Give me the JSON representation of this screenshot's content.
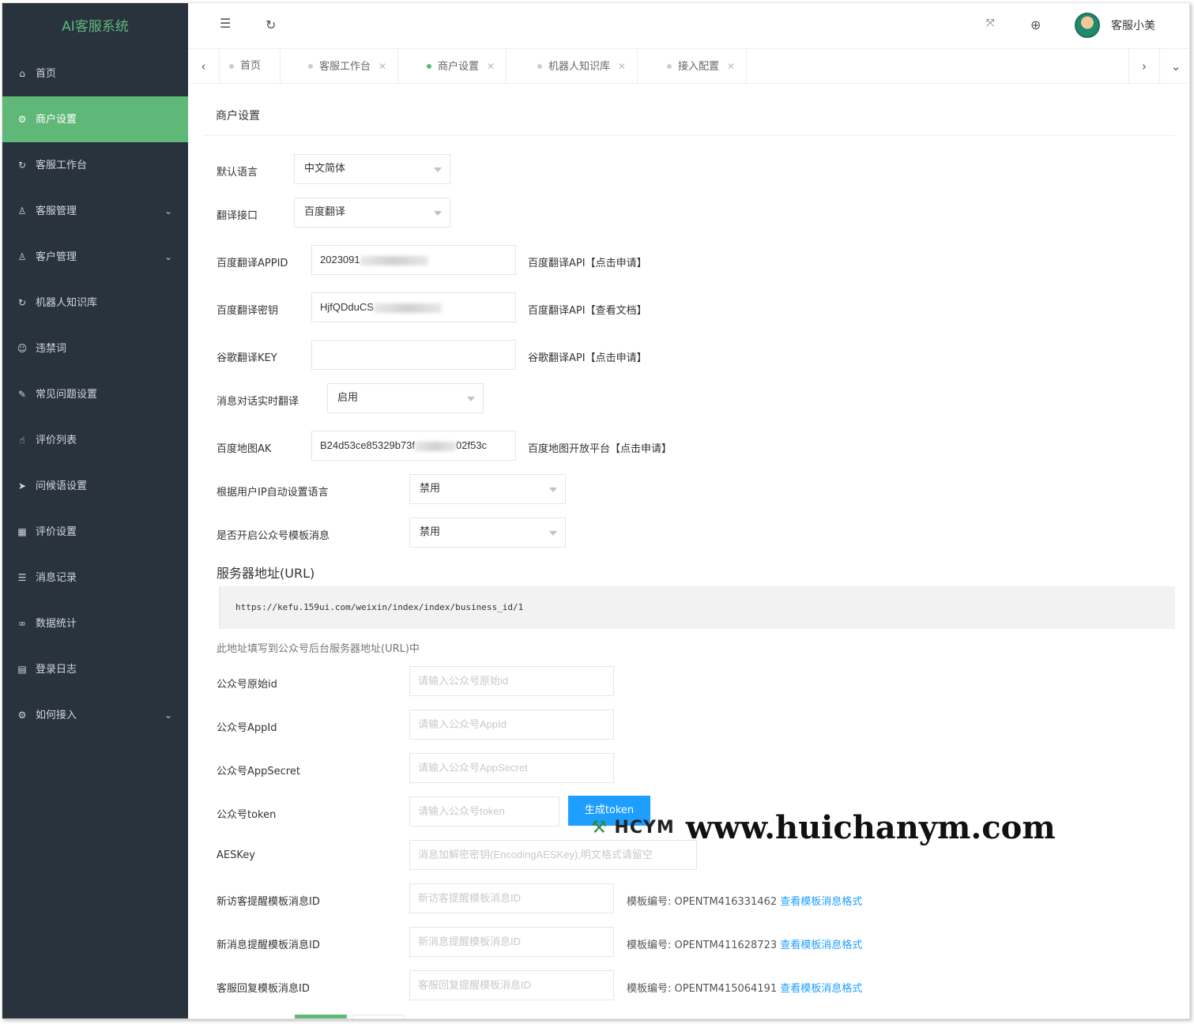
{
  "app": {
    "title": "AI客服系统"
  },
  "sidebar": {
    "items": [
      {
        "label": "首页",
        "icon": "home-icon",
        "glyph": "⌂"
      },
      {
        "label": "商户设置",
        "icon": "gear-icon",
        "glyph": "⚙"
      },
      {
        "label": "客服工作台",
        "icon": "refresh-icon",
        "glyph": "↻"
      },
      {
        "label": "客服管理",
        "icon": "user-icon",
        "glyph": "♙"
      },
      {
        "label": "客户管理",
        "icon": "users-icon",
        "glyph": "♙"
      },
      {
        "label": "机器人知识库",
        "icon": "refresh-icon",
        "glyph": "↻"
      },
      {
        "label": "违禁词",
        "icon": "face-icon",
        "glyph": "☺"
      },
      {
        "label": "常见问题设置",
        "icon": "edit-icon",
        "glyph": "✎"
      },
      {
        "label": "评价列表",
        "icon": "thumb-icon",
        "glyph": "☝"
      },
      {
        "label": "问候语设置",
        "icon": "send-icon",
        "glyph": "➤"
      },
      {
        "label": "评价设置",
        "icon": "calendar-icon",
        "glyph": "▦"
      },
      {
        "label": "消息记录",
        "icon": "list-icon",
        "glyph": "☰"
      },
      {
        "label": "数据统计",
        "icon": "link-icon",
        "glyph": "∞"
      },
      {
        "label": "登录日志",
        "icon": "table-icon",
        "glyph": "▤"
      },
      {
        "label": "如何接入",
        "icon": "gear-icon",
        "glyph": "⚙"
      }
    ],
    "active_index": 1,
    "expandable": [
      3,
      4,
      14
    ]
  },
  "header": {
    "menu_icon": "menu-icon",
    "refresh_icon": "refresh-icon",
    "fullscreen_icon": "fullscreen-icon",
    "globe_icon": "globe-icon",
    "username": "客服小美"
  },
  "tabs": [
    {
      "label": "首页",
      "closable": false
    },
    {
      "label": "客服工作台",
      "closable": true
    },
    {
      "label": "商户设置",
      "closable": true,
      "active": true
    },
    {
      "label": "机器人知识库",
      "closable": true
    },
    {
      "label": "接入配置",
      "closable": true
    }
  ],
  "page": {
    "title": "商户设置",
    "default_language": {
      "label": "默认语言",
      "value": "中文简体"
    },
    "translate_api": {
      "label": "翻译接口",
      "value": "百度翻译"
    },
    "baidu_appid": {
      "label": "百度翻译APPID",
      "value_start": "2023091",
      "value_end": "",
      "aside": "百度翻译API【点击申请】"
    },
    "baidu_secret": {
      "label": "百度翻译密钥",
      "value_start": "HjfQDduCS",
      "value_end": "",
      "aside": "百度翻译API【查看文档】"
    },
    "google_key": {
      "label": "谷歌翻译KEY",
      "value": "",
      "aside": "谷歌翻译API【点击申请】"
    },
    "realtime_translate": {
      "label": "消息对话实时翻译",
      "value": "启用"
    },
    "baidu_map_ak": {
      "label": "百度地图AK",
      "value_start": "B24d53ce85329b73f",
      "value_end": "02f53c",
      "aside": "百度地图开放平台【点击申请】"
    },
    "auto_language_by_ip": {
      "label": "根据用户IP自动设置语言",
      "value": "禁用"
    },
    "mp_template_msg": {
      "label": "是否开启公众号模板消息",
      "value": "禁用"
    },
    "server_url_heading": "服务器地址(URL)",
    "server_url": "https://kefu.159ui.com/weixin/index/index/business_id/1",
    "server_url_note": "此地址填写到公众号后台服务器地址(URL)中",
    "mp_original_id": {
      "label": "公众号原始id",
      "placeholder": "请输入公众号原始id"
    },
    "mp_appid": {
      "label": "公众号AppId",
      "placeholder": "请输入公众号AppId"
    },
    "mp_appsecret": {
      "label": "公众号AppSecret",
      "placeholder": "请输入公众号AppSecret"
    },
    "mp_token": {
      "label": "公众号token",
      "placeholder": "请输入公众号token",
      "button": "生成token"
    },
    "aes_key": {
      "label": "AESKey",
      "placeholder": "消息加解密密钥(EncodingAESKey),明文格式请留空"
    },
    "tpl_new_visitor": {
      "label": "新访客提醒模板消息ID",
      "placeholder": "新访客提醒模板消息ID",
      "info": "模板编号: OPENTM416331462",
      "link": "查看模板消息格式"
    },
    "tpl_new_message": {
      "label": "新消息提醒模板消息ID",
      "placeholder": "新消息提醒模板消息ID",
      "info": "模板编号: OPENTM411628723",
      "link": "查看模板消息格式"
    },
    "tpl_reply": {
      "label": "客服回复模板消息ID",
      "placeholder": "客服回复提醒模板消息ID",
      "info": "模板编号: OPENTM415064191",
      "link": "查看模板消息格式"
    }
  },
  "watermark": {
    "logo": "HCYM",
    "url": "www.huichanym.com"
  },
  "colors": {
    "sidebar_bg": "#28333e",
    "accent_green": "#5fb878",
    "link_blue": "#1e9fff"
  }
}
